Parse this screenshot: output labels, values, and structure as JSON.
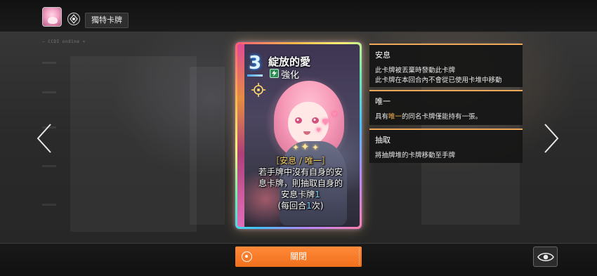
{
  "header": {
    "tag_label": "獨特卡牌",
    "caption": "— CCDI ondine ×"
  },
  "card": {
    "cost": "3",
    "name": "綻放的愛",
    "type": "強化",
    "desc_keywords": "［安息 / 唯一］",
    "desc_line1": "若手牌中沒有自身的安",
    "desc_line2": "息卡牌，則抽取自身的",
    "desc_line3_prefix": "安息卡牌",
    "desc_line3_num": "1",
    "desc_line4_prefix": "(每回合",
    "desc_line4_num": "1",
    "desc_line4_suffix": "次)"
  },
  "keywords": [
    {
      "title": "安息",
      "line1": "此卡牌被丟棄時發動此卡牌",
      "line2": "此卡牌在本回合內不會從已使用卡堆中移動"
    },
    {
      "title": "唯一",
      "line1_prefix": "具有",
      "line1_highlight": "唯一",
      "line1_suffix": "的同名卡牌僅能持有一張。"
    },
    {
      "title": "抽取",
      "line1": "將抽牌堆的卡牌移動至手牌"
    }
  ],
  "footer": {
    "close_label": "關閉"
  },
  "colors": {
    "accent_orange": "#f0701c",
    "keyword_border": "#f0a85a",
    "highlight": "#ffb347",
    "cost_blue": "#2a7bd4"
  },
  "icons": {
    "avatar": "character-portrait",
    "crest": "crest-icon",
    "left_arrow": "chevron-left-icon",
    "right_arrow": "chevron-right-icon",
    "eye": "eye-icon",
    "target": "crosshair-icon",
    "type": "lightning-icon"
  }
}
